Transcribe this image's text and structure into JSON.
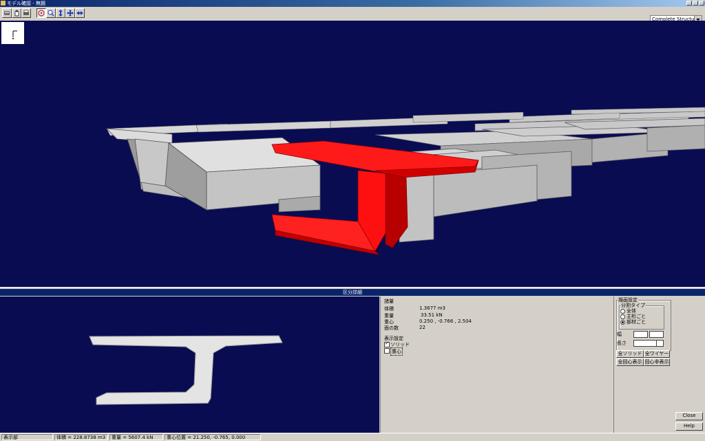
{
  "window": {
    "title": "モデル確認 - 無題"
  },
  "toolbar": {
    "buttons": [
      "open-icon",
      "hand-icon",
      "print-icon",
      "rotate-icon",
      "zoom-icon",
      "pan-y-icon",
      "move-icon",
      "fit-icon"
    ],
    "structure_select": "Complete Structure"
  },
  "section_header": "区分詳細",
  "properties": {
    "header": "諸量",
    "rows": [
      {
        "label": "体積",
        "value": "1.3677 m3"
      },
      {
        "label": "重量",
        "value": "33.51 kN"
      },
      {
        "label": "重心",
        "value": "0.250 , -0.766 , 2.504"
      },
      {
        "label": "面の数",
        "value": "22"
      }
    ],
    "display_header": "表示設定",
    "checks": [
      {
        "label": "ソリッド",
        "checked": true
      },
      {
        "label": "重心",
        "checked": false
      }
    ]
  },
  "drawing": {
    "group_label": "描画設定",
    "split_label": "分割タイプ",
    "radios": [
      {
        "label": "全体",
        "selected": false
      },
      {
        "label": "主桁ごと",
        "selected": false
      },
      {
        "label": "部材ごと",
        "selected": true
      }
    ],
    "width_label": "幅",
    "length_label": "長さ",
    "btn_all_solid": "全ソリッド",
    "btn_all_wire": "全ワイヤー",
    "btn_show_cog": "全回心表示",
    "btn_hide_cog": "回心非表示",
    "close": "Close",
    "help": "Help"
  },
  "status": {
    "mode": "表示部",
    "volume": "体積 = 228.8738 m3",
    "weight": "重量 = 5607.4 kN",
    "cog": "重心位置 = 21.250, -0.765, 0.000"
  }
}
